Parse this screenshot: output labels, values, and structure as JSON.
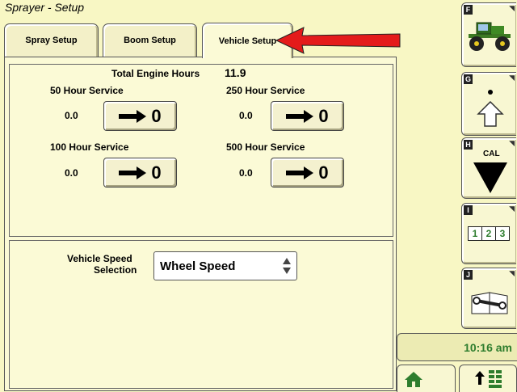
{
  "window": {
    "title": "Sprayer - Setup"
  },
  "tabs": [
    {
      "label": "Spray Setup"
    },
    {
      "label": "Boom Setup"
    },
    {
      "label": "Vehicle Setup"
    }
  ],
  "engine": {
    "label": "Total Engine Hours",
    "value": "11.9"
  },
  "services": [
    {
      "label": "50 Hour Service",
      "value": "0.0",
      "button": "0"
    },
    {
      "label": "250 Hour Service",
      "value": "0.0",
      "button": "0"
    },
    {
      "label": "100 Hour Service",
      "value": "0.0",
      "button": "0"
    },
    {
      "label": "500 Hour Service",
      "value": "0.0",
      "button": "0"
    }
  ],
  "speed": {
    "label_line1": "Vehicle Speed",
    "label_line2": "Selection",
    "value": "Wheel Speed"
  },
  "softkeys": {
    "F": {
      "letter": "F"
    },
    "G": {
      "letter": "G"
    },
    "H": {
      "letter": "H",
      "text": "CAL"
    },
    "I": {
      "letter": "I",
      "digits": [
        "1",
        "2",
        "3"
      ]
    },
    "J": {
      "letter": "J"
    }
  },
  "clock": {
    "time": "10:16 am"
  },
  "colors": {
    "background": "#f8f7c4",
    "arrow": "#e41b1b",
    "accent_green": "#2e7d2e"
  },
  "icons": [
    "tractor-sprayer-icon",
    "dot-icon",
    "up-arrow-icon",
    "down-triangle-icon",
    "wrench-book-icon",
    "home-icon",
    "up-arrow-grid-icon",
    "right-arrow-icon",
    "spinner-arrows-icon"
  ]
}
